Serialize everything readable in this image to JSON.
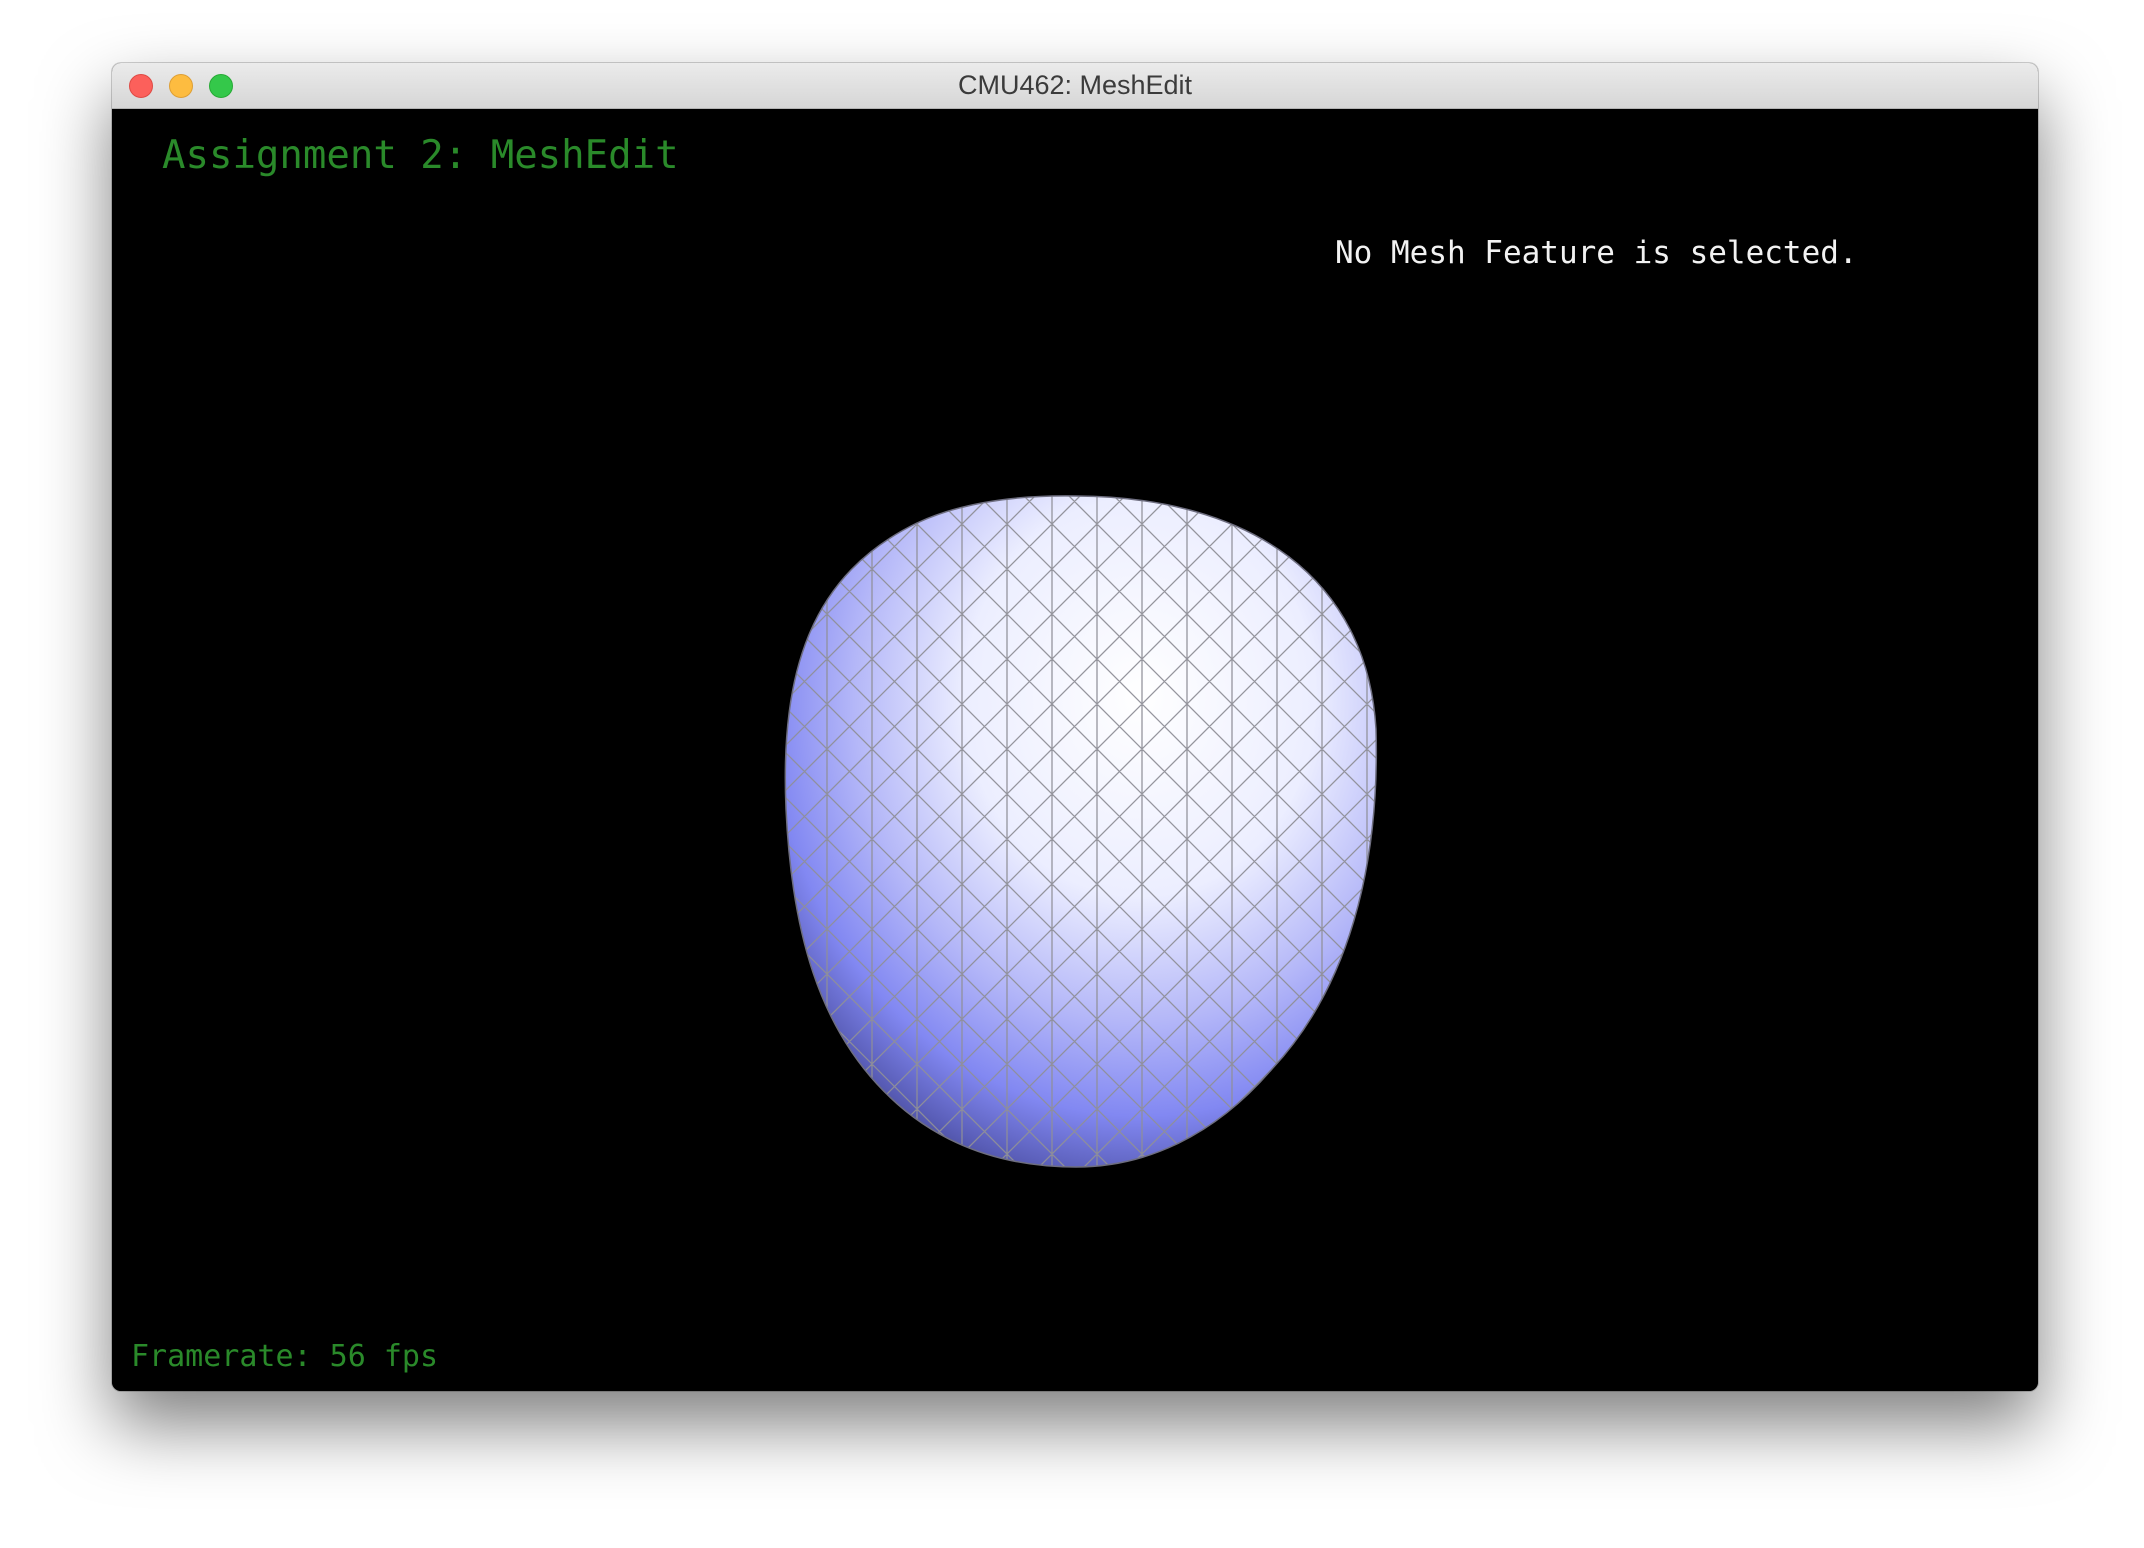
{
  "window": {
    "title": "CMU462: MeshEdit"
  },
  "viewport": {
    "heading": "Assignment 2: MeshEdit",
    "selection_info": "No Mesh Feature is selected.",
    "framerate": "Framerate: 56 fps"
  },
  "colors": {
    "background": "#000000",
    "heading": "#2a8a2a",
    "mesh_highlight": "#ffffff",
    "mesh_mid": "#b4b7f8",
    "mesh_shadow": "#8288f2",
    "mesh_dark": "#3d4088",
    "wireframe": "#8f8f98"
  },
  "icons": [
    "close-icon",
    "minimize-icon",
    "zoom-icon"
  ]
}
